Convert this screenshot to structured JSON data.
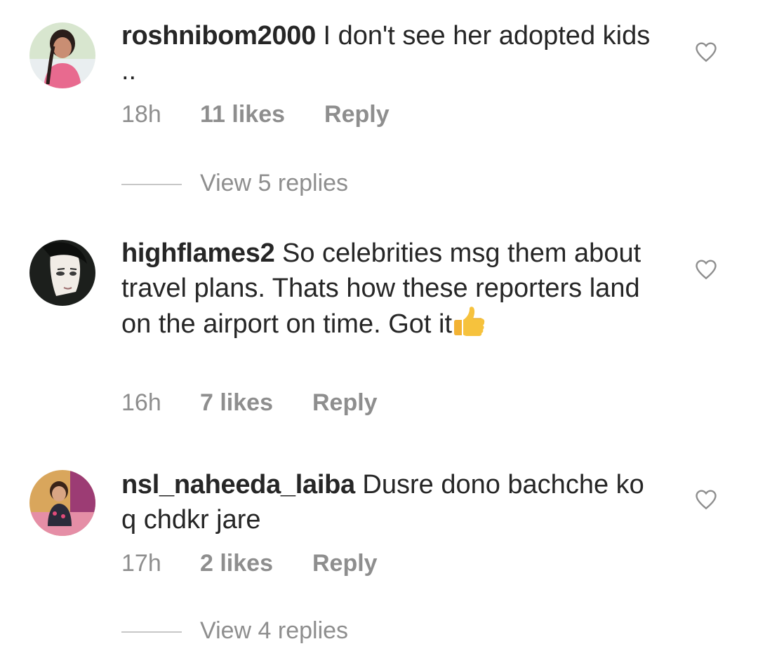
{
  "comments": [
    {
      "username": "roshnibom2000",
      "text": " I don't see her adopted kids ..",
      "time": "18h",
      "likes": "11 likes",
      "reply": "Reply",
      "view_replies": "View 5 replies",
      "liked": false
    },
    {
      "username": "highflames2",
      "text": " So celebrities msg them about travel plans. Thats how these reporters land on the airport on time. Got it",
      "time": "16h",
      "likes": "7 likes",
      "reply": "Reply",
      "view_replies": null,
      "liked": false
    },
    {
      "username": "nsl_naheeda_laiba",
      "text": " Dusre dono bachche ko q chdkr jare",
      "time": "17h",
      "likes": "2 likes",
      "reply": "Reply",
      "view_replies": "View 4 replies",
      "liked": false
    }
  ],
  "icons": {
    "like": "heart-outline-icon",
    "emoji": "thumbs-up-emoji"
  },
  "colors": {
    "text": "#262626",
    "secondary": "#8e8e8e",
    "divider": "#c7c7c7"
  }
}
